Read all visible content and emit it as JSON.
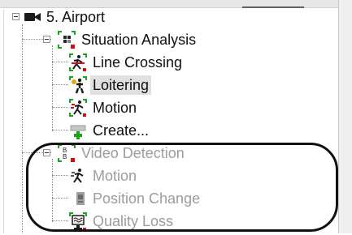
{
  "tree": {
    "root": {
      "label": "5. Airport",
      "icon": "camera-icon"
    },
    "situation": {
      "label": "Situation Analysis",
      "icon": "situation-analysis-icon",
      "items": [
        {
          "label": "Line Crossing",
          "icon": "line-crossing-icon"
        },
        {
          "label": "Loitering",
          "icon": "loitering-icon",
          "selected": true
        },
        {
          "label": "Motion",
          "icon": "motion-icon"
        },
        {
          "label": "Create...",
          "icon": "create-icon"
        }
      ]
    },
    "video": {
      "label": "Video Detection",
      "icon": "video-detection-icon",
      "items": [
        {
          "label": "Motion",
          "icon": "motion-icon"
        },
        {
          "label": "Position Change",
          "icon": "position-change-icon"
        },
        {
          "label": "Quality Loss",
          "icon": "quality-loss-icon"
        }
      ]
    }
  },
  "colors": {
    "accent_green": "#1aa61a",
    "accent_red": "#d01010",
    "disabled_text": "#9c9c9c"
  }
}
